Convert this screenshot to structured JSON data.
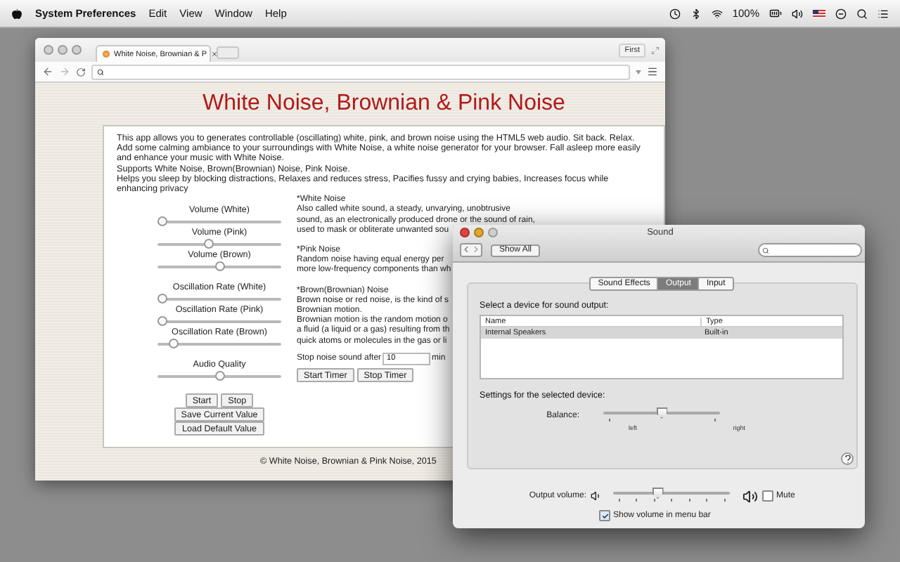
{
  "menu_bar": {
    "app_name": "System Preferences",
    "menus": [
      "Edit",
      "View",
      "Window",
      "Help"
    ],
    "battery": "100%"
  },
  "browser": {
    "tab": {
      "title": "White Noise, Brownian & P"
    },
    "profile_button": "First"
  },
  "page": {
    "title": "White Noise, Brownian & Pink Noise",
    "intro": [
      "This app allows you to generates controllable (oscillating) white, pink, and brown noise using the HTML5 web audio. Sit back. Relax. Add some calming ambiance to your surroundings with White Noise, a white noise generator for your browser. Fall asleep more easily and enhance your music with White Noise.",
      "Supports White Noise, Brown(Brownian) Noise, Pink Noise.",
      "Helps you sleep by blocking distractions, Relaxes and reduces stress, Pacifies fussy and crying babies, Increases focus while enhancing privacy"
    ],
    "slider_groups": [
      {
        "sliders": [
          {
            "label": "Volume (White)",
            "level": 0.0
          },
          {
            "label": "Volume (Pink)",
            "level": 0.41
          },
          {
            "label": "Volume (Brown)",
            "level": 0.5
          }
        ]
      },
      {
        "sliders": [
          {
            "label": "Oscillation Rate (White)",
            "level": 0.0
          },
          {
            "label": "Oscillation Rate (Pink)",
            "level": 0.0
          },
          {
            "label": "Oscillation Rate (Brown)",
            "level": 0.1
          }
        ]
      },
      {
        "sliders": [
          {
            "label": "Audio Quality",
            "level": 0.5
          }
        ]
      }
    ],
    "start_stop": [
      "Start",
      "Stop"
    ],
    "value_buttons": [
      "Save Current Value",
      "Load Default Value"
    ],
    "descriptions": [
      {
        "heading": "*White Noise",
        "lines": [
          "Also called white sound, a steady, unvarying, unobtrusive",
          "sound, as an electronically produced drone or the sound of rain,",
          "used to mask or obliterate unwanted sou"
        ]
      },
      {
        "heading": "*Pink Noise",
        "lines": [
          "Random noise having equal energy per",
          "more low-frequency components than wh"
        ]
      },
      {
        "heading": "*Brown(Brownian) Noise",
        "lines": [
          "Brown noise or red noise, is the kind of s",
          "Brownian motion.",
          "Brownian motion is the random motion o",
          "a fluid (a liquid or a gas) resulting from th",
          "quick atoms or molecules in the gas or li"
        ]
      }
    ],
    "timer": {
      "label": "Stop noise sound after",
      "value": "10",
      "unit": "min",
      "buttons": [
        "Start Timer",
        "Stop Timer"
      ]
    },
    "footer": "© White Noise, Brownian & Pink Noise, 2015"
  },
  "sound_window": {
    "title": "Sound",
    "show_all": "Show All",
    "tabs": [
      {
        "label": "Sound Effects",
        "selected": false
      },
      {
        "label": "Output",
        "selected": true
      },
      {
        "label": "Input",
        "selected": false
      }
    ],
    "device_heading": "Select a device for sound output:",
    "table": {
      "columns": [
        "Name",
        "Type"
      ],
      "rows": [
        {
          "cells": [
            "Internal Speakers",
            "Built-in"
          ],
          "selected": true
        }
      ]
    },
    "settings_heading": "Settings for the selected device:",
    "balance": {
      "label": "Balance:",
      "level": 0.5,
      "left": "left",
      "right": "right"
    },
    "output_volume": {
      "label": "Output volume:",
      "level": 0.37
    },
    "mute": {
      "label": "Mute",
      "checked": false
    },
    "show_in_menu_bar": {
      "label": "Show volume in menu bar",
      "checked": true
    }
  }
}
